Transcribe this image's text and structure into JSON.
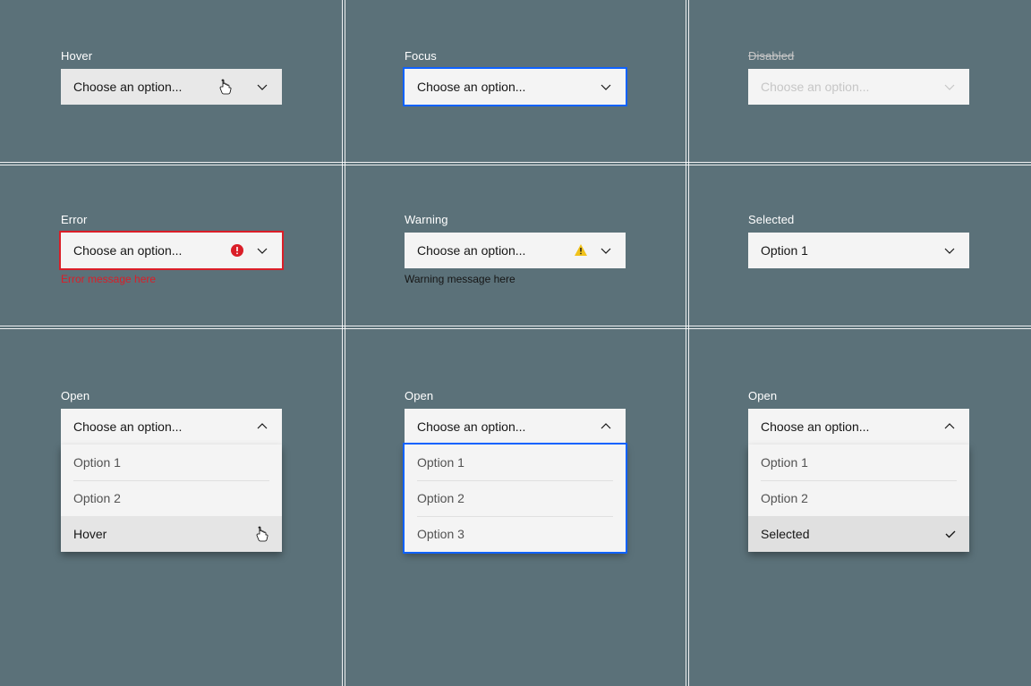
{
  "states": {
    "hover": {
      "label": "Hover",
      "text": "Choose an option..."
    },
    "focus": {
      "label": "Focus",
      "text": "Choose an option..."
    },
    "disabled": {
      "label": "Disabled",
      "text": "Choose an option..."
    },
    "error": {
      "label": "Error",
      "text": "Choose an option...",
      "helper": "Error message here"
    },
    "warning": {
      "label": "Warning",
      "text": "Choose an option...",
      "helper": "Warning message here"
    },
    "selected": {
      "label": "Selected",
      "text": "Option 1"
    }
  },
  "open_a": {
    "label": "Open",
    "header": "Choose an option...",
    "items": [
      {
        "label": "Option 1"
      },
      {
        "label": "Option 2"
      },
      {
        "label": "Hover"
      }
    ]
  },
  "open_b": {
    "label": "Open",
    "header": "Choose an option...",
    "items": [
      {
        "label": "Option 1"
      },
      {
        "label": "Option 2"
      },
      {
        "label": "Option 3"
      }
    ]
  },
  "open_c": {
    "label": "Open",
    "header": "Choose an option...",
    "items": [
      {
        "label": "Option 1"
      },
      {
        "label": "Option 2"
      },
      {
        "label": "Selected"
      }
    ]
  }
}
